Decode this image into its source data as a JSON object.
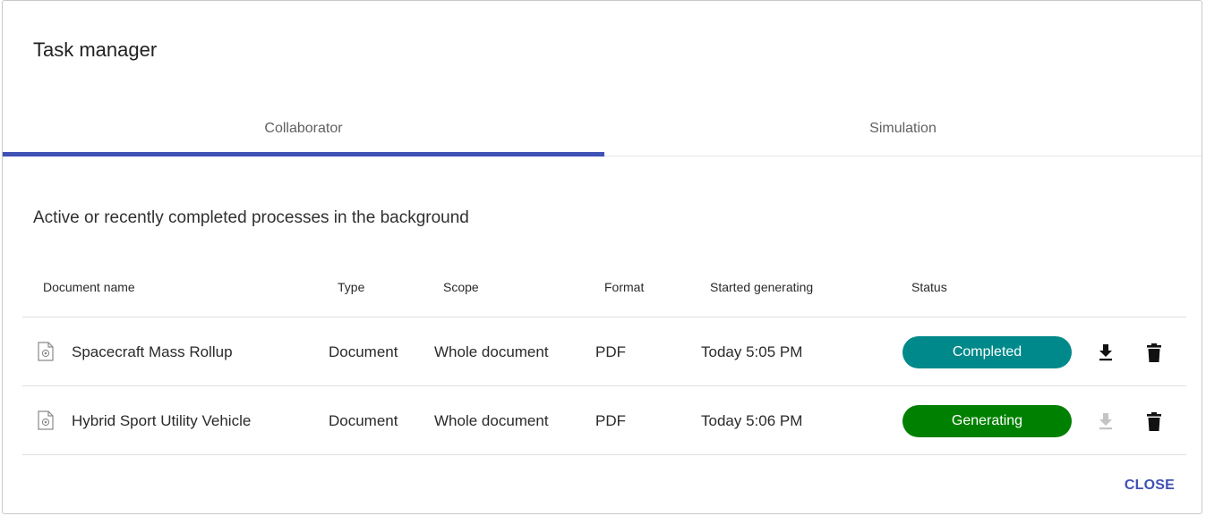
{
  "dialog": {
    "title": "Task manager",
    "tabs": [
      {
        "label": "Collaborator",
        "active": true
      },
      {
        "label": "Simulation",
        "active": false
      }
    ],
    "subtitle": "Active or recently completed processes in the background",
    "close_label": "CLOSE"
  },
  "table": {
    "headers": {
      "name": "Document name",
      "type": "Type",
      "scope": "Scope",
      "format": "Format",
      "started": "Started generating",
      "status": "Status"
    },
    "rows": [
      {
        "icon": "document-file-icon",
        "name": "Spacecraft Mass Rollup",
        "type": "Document",
        "scope": "Whole document",
        "format": "PDF",
        "started": "Today 5:05 PM",
        "status": "Completed",
        "status_color": "#00898a",
        "download_enabled": true
      },
      {
        "icon": "document-file-icon",
        "name": "Hybrid Sport Utility Vehicle",
        "type": "Document",
        "scope": "Whole document",
        "format": "PDF",
        "started": "Today 5:06 PM",
        "status": "Generating",
        "status_color": "#008000",
        "download_enabled": false
      }
    ]
  },
  "colors": {
    "accent": "#3f51b5",
    "completed": "#00898a",
    "generating": "#008000",
    "icon_active": "#111111",
    "icon_disabled": "#c4c4c4"
  }
}
